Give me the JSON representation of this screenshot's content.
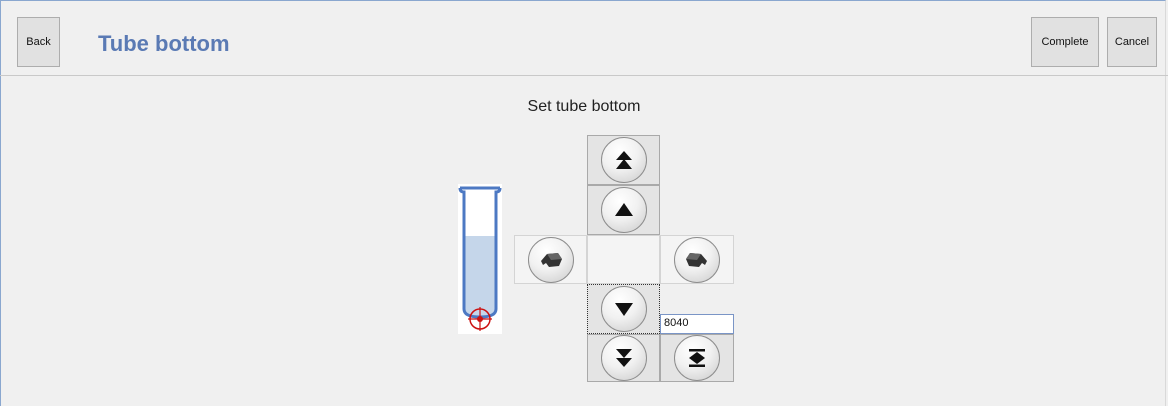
{
  "header": {
    "back_label": "Back",
    "title": "Tube bottom",
    "complete_label": "Complete",
    "cancel_label": "Cancel"
  },
  "main": {
    "instruction": "Set tube bottom",
    "position_value": "8040"
  },
  "icons": {
    "fast_up": "double-up-arrow-icon",
    "up": "up-arrow-icon",
    "rotate_left": "rotate-left-icon",
    "rotate_right": "rotate-right-icon",
    "down": "down-arrow-icon",
    "fast_down": "double-down-arrow-icon",
    "to_bottom": "go-to-bottom-icon"
  },
  "colors": {
    "title": "#5a7ab4",
    "tube_outline": "#4d79c3",
    "tube_fill": "#c5d6ea",
    "target_marker": "#cc1111"
  }
}
